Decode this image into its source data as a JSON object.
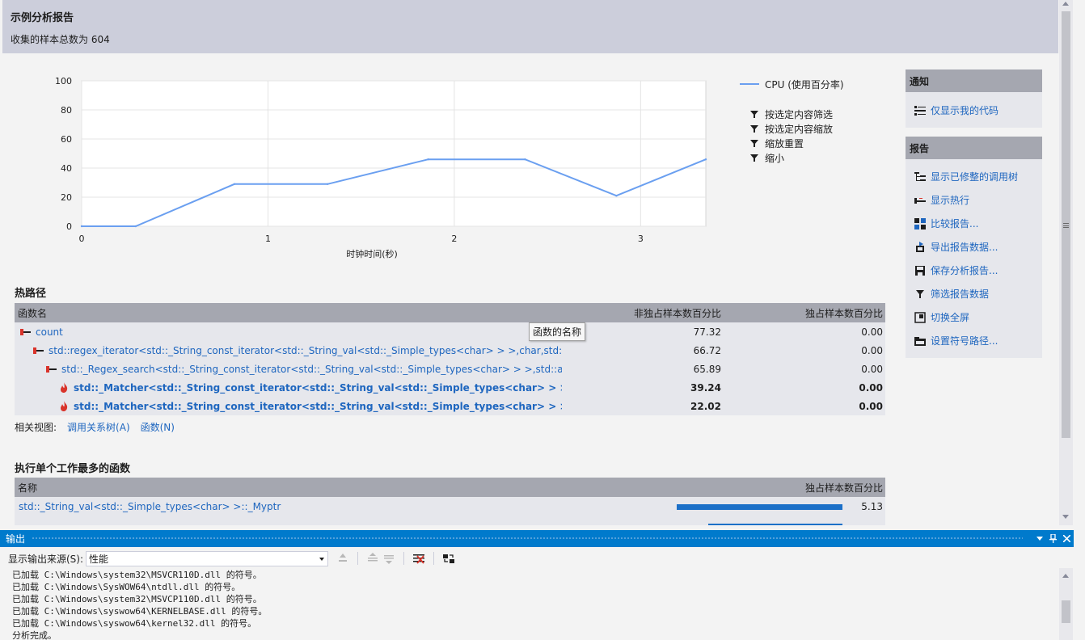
{
  "report": {
    "title": "示例分析报告",
    "subtitle": "收集的样本总数为 604"
  },
  "chart_data": {
    "type": "line",
    "title": "",
    "xlabel": "时钟时间(秒)",
    "ylabel": "",
    "xlim": [
      0,
      3.35
    ],
    "ylim": [
      0,
      100
    ],
    "x_ticks": [
      "0",
      "1",
      "2",
      "3"
    ],
    "y_ticks": [
      "0",
      "20",
      "40",
      "60",
      "80",
      "100"
    ],
    "grid": true,
    "series": [
      {
        "name": "CPU (使用百分率)",
        "color": "#6a9ff0",
        "x": [
          0,
          0.29,
          0.82,
          1.32,
          1.86,
          2.38,
          2.87,
          3.35
        ],
        "y": [
          0,
          0,
          29,
          29,
          46,
          46,
          21,
          46
        ]
      }
    ]
  },
  "chart_actions": [
    "按选定内容筛选",
    "按选定内容缩放",
    "缩放重置",
    "缩小"
  ],
  "hotpath": {
    "title": "热路径",
    "columns": [
      "函数名",
      "非独占样本数百分比",
      "独占样本数百分比"
    ],
    "rows": [
      {
        "name": "count",
        "inclusive": "77.32",
        "exclusive": "0.00",
        "icon": "hot-path-icon",
        "bold": false
      },
      {
        "name": "std::regex_iterator<std::_String_const_iterator<std::_String_val<std::_Simple_types<char> > >,char,std::rege...",
        "inclusive": "66.72",
        "exclusive": "0.00",
        "icon": "hot-path-icon",
        "bold": false
      },
      {
        "name": "std::_Regex_search<std::_String_const_iterator<std::_String_val<std::_Simple_types<char> > >,std::alloca...",
        "inclusive": "65.89",
        "exclusive": "0.00",
        "icon": "hot-path-icon",
        "bold": false
      },
      {
        "name": "std::_Matcher<std::_String_const_iterator<std::_String_val<std::_Simple_types<char>  > >,char,st...",
        "inclusive": "39.24",
        "exclusive": "0.00",
        "icon": "flame-icon",
        "bold": true
      },
      {
        "name": "std::_Matcher<std::_String_const_iterator<std::_String_val<std::_Simple_types<char>  > >,char,st...",
        "inclusive": "22.02",
        "exclusive": "0.00",
        "icon": "flame-icon",
        "bold": true
      }
    ],
    "tooltip": "函数的名称"
  },
  "related": {
    "label": "相关视图:",
    "links": [
      "调用关系树(A)",
      "函数(N)"
    ]
  },
  "most_work": {
    "title": "执行单个工作最多的函数",
    "columns": [
      "名称",
      "独占样本数百分比"
    ],
    "rows": [
      {
        "name": "std::_String_val<std::_Simple_types<char> >::_Myptr",
        "value": "5.13",
        "fraction": 1.0
      },
      {
        "name": "",
        "value": "",
        "fraction": 0.81
      }
    ]
  },
  "notify": {
    "title": "通知",
    "items": [
      {
        "label": "仅显示我的代码",
        "icon": "just-my-code-icon"
      }
    ]
  },
  "reports": {
    "title": "报告",
    "items": [
      {
        "label": "显示已修整的调用树",
        "icon": "call-tree-icon"
      },
      {
        "label": "显示热行",
        "icon": "hot-lines-icon"
      },
      {
        "label": "比较报告...",
        "icon": "compare-icon"
      },
      {
        "label": "导出报告数据...",
        "icon": "export-icon"
      },
      {
        "label": "保存分析报告...",
        "icon": "save-icon"
      },
      {
        "label": "筛选报告数据",
        "icon": "filter-icon"
      },
      {
        "label": "切换全屏",
        "icon": "fullscreen-icon"
      },
      {
        "label": "设置符号路径...",
        "icon": "symbol-path-icon"
      }
    ]
  },
  "output": {
    "title": "输出",
    "source_label": "显示输出来源(S):",
    "source_value": "性能",
    "lines": [
      "已加载 C:\\Windows\\system32\\MSVCR110D.dll 的符号。",
      "已加载 C:\\Windows\\SysWOW64\\ntdll.dll 的符号。",
      "已加载 C:\\Windows\\system32\\MSVCP110D.dll 的符号。",
      "已加载 C:\\Windows\\syswow64\\KERNELBASE.dll 的符号。",
      "已加载 C:\\Windows\\syswow64\\kernel32.dll 的符号。",
      "分析完成。"
    ]
  }
}
